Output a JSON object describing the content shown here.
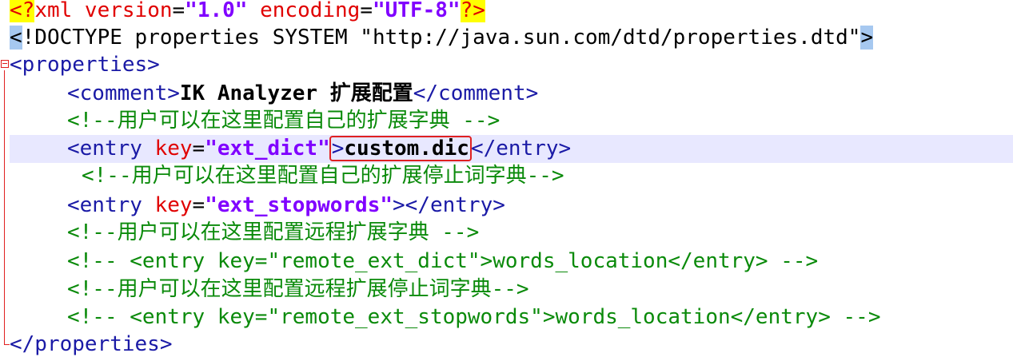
{
  "editor": {
    "lines": {
      "l1": {
        "pi_open": "<?",
        "pi_name": "xml",
        "attr1": " version",
        "eq1": "=",
        "val1": "\"1.0\"",
        "attr2": " encoding",
        "eq2": "=",
        "val2": "\"UTF-8\"",
        "pi_close": "?>"
      },
      "l2": {
        "bracket_open": "<",
        "text": "!DOCTYPE properties SYSTEM \"http://java.sun.com/dtd/properties.dtd\"",
        "bracket_close": ">"
      },
      "l3": {
        "tag": "<properties>"
      },
      "l4": {
        "open": "<comment>",
        "text": "IK Analyzer 扩展配置",
        "close": "</comment>"
      },
      "l5": {
        "comment": "<!--用户可以在这里配置自己的扩展字典 -->"
      },
      "l6": {
        "open": "<entry",
        "attr": " key",
        "eq": "=",
        "val": "\"ext_dict\"",
        "gt": ">",
        "text": "custom.dic",
        "close": "</entry>"
      },
      "l7": {
        "comment": "<!--用户可以在这里配置自己的扩展停止词字典-->"
      },
      "l8": {
        "open": "<entry",
        "attr": " key",
        "eq": "=",
        "val": "\"ext_stopwords\"",
        "close": "></entry>"
      },
      "l9": {
        "comment": "<!--用户可以在这里配置远程扩展字典 -->"
      },
      "l10": {
        "comment": "<!-- <entry key=\"remote_ext_dict\">words_location</entry> -->"
      },
      "l11": {
        "comment": "<!--用户可以在这里配置远程扩展停止词字典-->"
      },
      "l12": {
        "comment": "<!-- <entry key=\"remote_ext_stopwords\">words_location</entry> -->"
      },
      "l13": {
        "tag": "</properties>"
      }
    }
  },
  "colors": {
    "tag": "#1a1aa6",
    "attribute": "#e00000",
    "value": "#8000ff",
    "comment": "#0a8a0a",
    "current_line": "#e8e8ff",
    "highlight_box": "#e02020"
  }
}
